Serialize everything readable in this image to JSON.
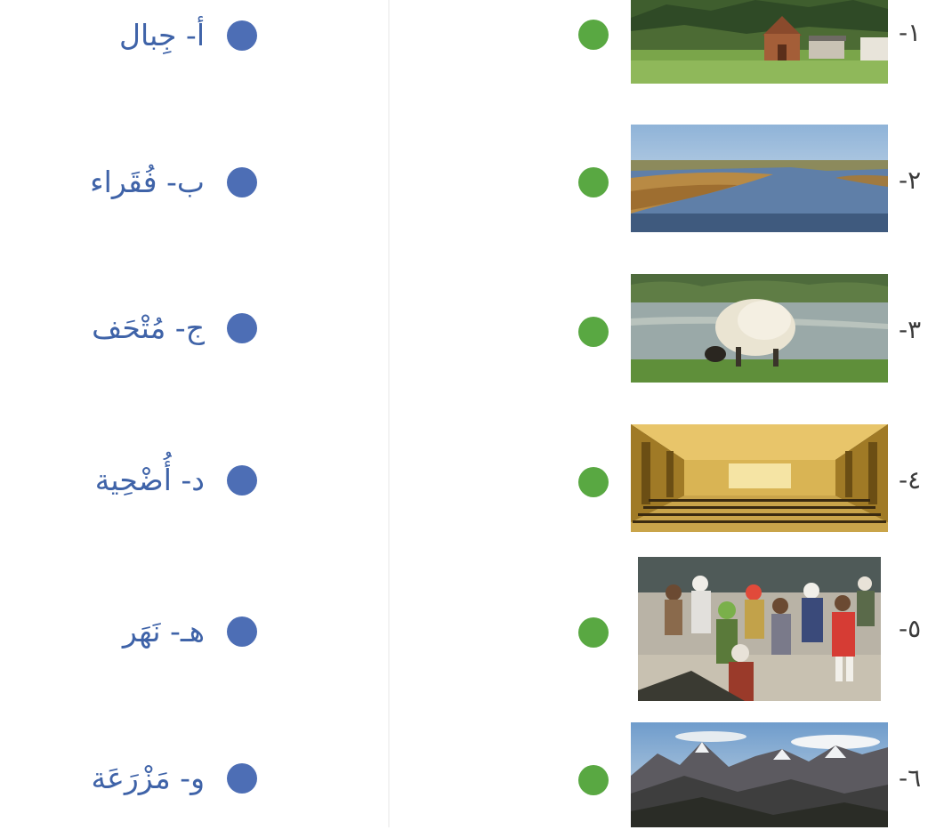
{
  "words": [
    {
      "letter": "أ",
      "word": "جِبال"
    },
    {
      "letter": "ب",
      "word": "فُقَراء"
    },
    {
      "letter": "ج",
      "word": "مُتْحَف"
    },
    {
      "letter": "د",
      "word": "أُضْحِية"
    },
    {
      "letter": "هـ",
      "word": "نَهَر"
    },
    {
      "letter": "و",
      "word": "مَزْرَعَة"
    }
  ],
  "pictures": [
    {
      "number": "-١",
      "subject": "farm-photo"
    },
    {
      "number": "-٢",
      "subject": "river-photo"
    },
    {
      "number": "-٣",
      "subject": "sheep-photo"
    },
    {
      "number": "-٤",
      "subject": "museum-hall-photo"
    },
    {
      "number": "-٥",
      "subject": "crowd-photo"
    },
    {
      "number": "-٦",
      "subject": "mountains-photo"
    }
  ],
  "colors": {
    "blue_dot": "#4d6eb5",
    "green_dot": "#59a842",
    "word_text": "#3f63a8"
  }
}
